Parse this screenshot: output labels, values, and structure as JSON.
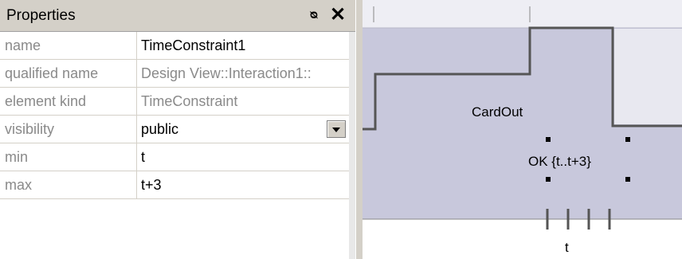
{
  "panel": {
    "title": "Properties",
    "pin_icon": "pin-icon",
    "close_icon": "close-icon",
    "pin_glyph": "ᵖ",
    "close_glyph": "✕",
    "rows": [
      {
        "name": "name",
        "value": "TimeConstraint1"
      },
      {
        "name": "qualified name",
        "value": "Design View::Interaction1::"
      },
      {
        "name": "element kind",
        "value": "TimeConstraint"
      },
      {
        "name": "visibility",
        "value": "public"
      },
      {
        "name": "min",
        "value": "t"
      },
      {
        "name": "max",
        "value": "t+3"
      }
    ]
  },
  "diagram": {
    "lifeline_state": "CardOut",
    "constraint_label": "OK  {t..t+3}",
    "tick_label": "t",
    "colors": {
      "fill": "#c8c8dc",
      "header": "#e8e8f0",
      "stroke": "#555555"
    }
  }
}
